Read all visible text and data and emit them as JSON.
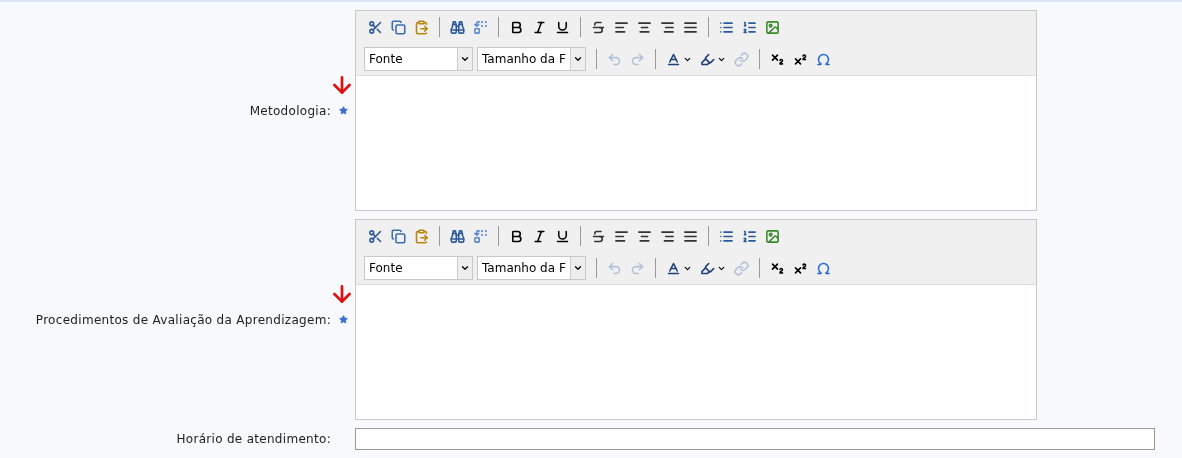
{
  "fields": [
    {
      "label": "Metodologia:",
      "required": true,
      "marked": true,
      "kind": "editor",
      "toolbar": [
        [
          {
            "kind": "cut"
          },
          {
            "kind": "copy"
          },
          {
            "kind": "paste"
          },
          {
            "kind": "separator"
          },
          {
            "kind": "find"
          },
          {
            "kind": "replace"
          },
          {
            "kind": "separator"
          },
          {
            "kind": "bold"
          },
          {
            "kind": "italic"
          },
          {
            "kind": "underline"
          },
          {
            "kind": "separator"
          },
          {
            "kind": "strike"
          },
          {
            "kind": "align-left"
          },
          {
            "kind": "align-center"
          },
          {
            "kind": "align-right"
          },
          {
            "kind": "justify"
          },
          {
            "kind": "separator"
          },
          {
            "kind": "bullets"
          },
          {
            "kind": "numbers"
          },
          {
            "kind": "image"
          }
        ],
        [
          {
            "kind": "select",
            "value": "Fonte"
          },
          {
            "kind": "select",
            "value": "Tamanho da F"
          },
          {
            "kind": "separator"
          },
          {
            "kind": "undo",
            "disabled": true
          },
          {
            "kind": "redo",
            "disabled": true
          },
          {
            "kind": "separator"
          },
          {
            "kind": "text-color"
          },
          {
            "kind": "highlight"
          },
          {
            "kind": "link",
            "disabled": true
          },
          {
            "kind": "separator"
          },
          {
            "kind": "subscript"
          },
          {
            "kind": "superscript"
          },
          {
            "kind": "omega"
          }
        ]
      ]
    },
    {
      "label": "Procedimentos de Avaliação da Aprendizagem:",
      "required": true,
      "marked": true,
      "kind": "editor",
      "toolbar": [
        [
          {
            "kind": "cut"
          },
          {
            "kind": "copy"
          },
          {
            "kind": "paste"
          },
          {
            "kind": "separator"
          },
          {
            "kind": "find"
          },
          {
            "kind": "replace"
          },
          {
            "kind": "separator"
          },
          {
            "kind": "bold"
          },
          {
            "kind": "italic"
          },
          {
            "kind": "underline"
          },
          {
            "kind": "separator"
          },
          {
            "kind": "strike"
          },
          {
            "kind": "align-left"
          },
          {
            "kind": "align-center"
          },
          {
            "kind": "align-right"
          },
          {
            "kind": "justify"
          },
          {
            "kind": "separator"
          },
          {
            "kind": "bullets"
          },
          {
            "kind": "numbers"
          },
          {
            "kind": "image"
          }
        ],
        [
          {
            "kind": "select",
            "value": "Fonte"
          },
          {
            "kind": "select",
            "value": "Tamanho da F"
          },
          {
            "kind": "separator"
          },
          {
            "kind": "undo",
            "disabled": true
          },
          {
            "kind": "redo",
            "disabled": true
          },
          {
            "kind": "separator"
          },
          {
            "kind": "text-color"
          },
          {
            "kind": "highlight"
          },
          {
            "kind": "link",
            "disabled": true
          },
          {
            "kind": "separator"
          },
          {
            "kind": "subscript"
          },
          {
            "kind": "superscript"
          },
          {
            "kind": "omega"
          }
        ]
      ]
    },
    {
      "label": "Horário de atendimento:",
      "required": false,
      "marked": false,
      "kind": "text"
    }
  ]
}
